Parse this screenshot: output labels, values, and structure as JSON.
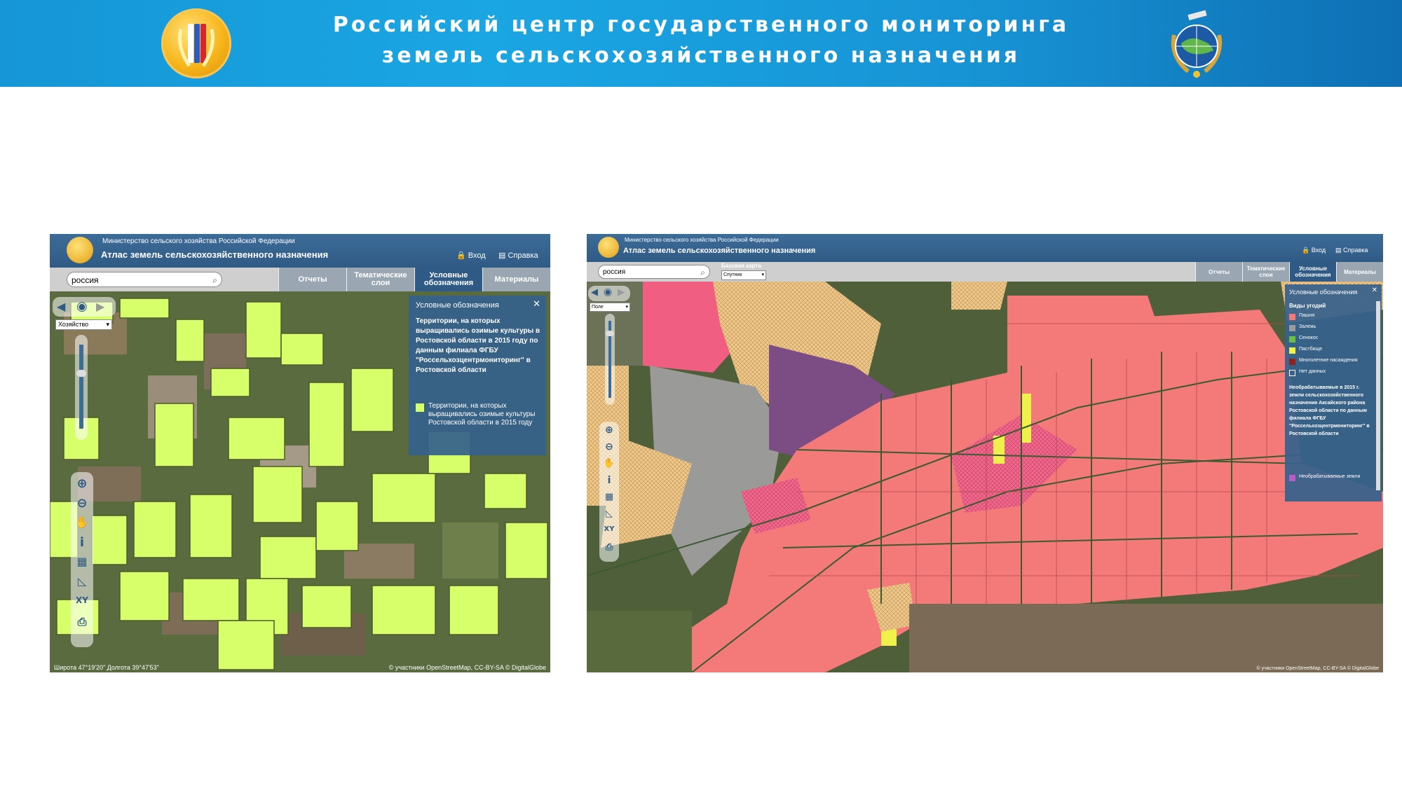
{
  "banner": {
    "line1": "Российский центр государственного мониторинга",
    "line2": "земель сельскохозяйственного назначения"
  },
  "left": {
    "ministry": "Министерство сельского хозяйства Российской Федерации",
    "atlas_title": "Атлас земель сельскохозяйственного назначения",
    "login": "Вход",
    "help": "Справка",
    "search_value": "россия",
    "tabs": [
      "Отчеты",
      "Тематические слои",
      "Условные обозначения",
      "Материалы"
    ],
    "layer_select": "Хозяйство",
    "legend": {
      "title": "Условные обозначения",
      "heading": "Территории, на которых выращивались озимые культуры в Ростовской области в 2015 году по данным филиала ФГБУ \"Россельхозцентрмониторинг\" в Ростовской области",
      "item": "Территории, на которых выращивались озимые культуры Ростовской области в 2015 году",
      "item_color": "#d6ff6a"
    },
    "coords": "Широта 47°19'20\"  Долгота 39°47'53\"",
    "credit": "© участники OpenStreetMap, CC-BY-SA © DigitalGlobe"
  },
  "right": {
    "ministry": "Министерство сельского хозяйства Российской Федерации",
    "atlas_title": "Атлас земель сельскохозяйственного назначения",
    "login": "Вход",
    "help": "Справка",
    "search_value": "россия",
    "basemap_label": "Базовая карта",
    "basemap_value": "Спутник",
    "tabs": [
      "Отчеты",
      "Тематические слои",
      "Условные обозначения",
      "Материалы"
    ],
    "layer_select": "Поле",
    "legend": {
      "title": "Условные обозначения",
      "section": "Виды угодий",
      "items": [
        {
          "label": "Пашня",
          "color": "#f47a7a"
        },
        {
          "label": "Залежь",
          "color": "#9a9a9a"
        },
        {
          "label": "Сенокос",
          "color": "#6cc04a"
        },
        {
          "label": "Пастбище",
          "color": "#f0f04a"
        },
        {
          "label": "Многолетние насаждения",
          "color": "#8b2323"
        },
        {
          "label": "Нет данных",
          "color": "#3e6b96"
        }
      ],
      "note": "Необрабатываемые в 2015 г. земли сельскохозяйственного назначения Аксайского района Ростовской области по данным филиала ФГБУ \"Россельхозцентрмониторинг\" в Ростовской области",
      "unused": "Необрабатываемые земли",
      "unused_color": "#b85cc7"
    },
    "credit": "© участники OpenStreetMap, CC-BY-SA © DigitalGlobe"
  }
}
